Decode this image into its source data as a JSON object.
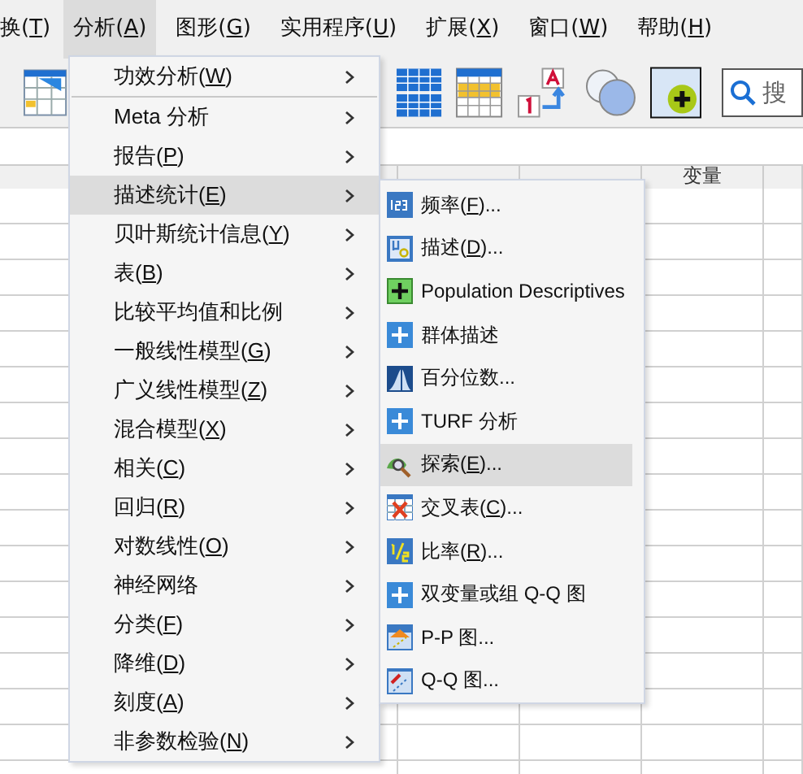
{
  "menubar": [
    {
      "label": "换(T)",
      "selected": false
    },
    {
      "label": "分析(A)",
      "selected": true
    },
    {
      "label": "图形(G)",
      "selected": false
    },
    {
      "label": "实用程序(U)",
      "selected": false
    },
    {
      "label": "扩展(X)",
      "selected": false
    },
    {
      "label": "窗口(W)",
      "selected": false
    },
    {
      "label": "帮助(H)",
      "selected": false
    }
  ],
  "toolbar": {
    "search": {
      "placeholder": "搜"
    }
  },
  "grid": {
    "column_header": "变量"
  },
  "analyze_menu": [
    {
      "label": "功效分析(W)",
      "selected": false,
      "separator_after": true
    },
    {
      "label": "Meta 分析",
      "selected": false
    },
    {
      "label": "报告(P)",
      "selected": false
    },
    {
      "label": "描述统计(E)",
      "selected": true
    },
    {
      "label": "贝叶斯统计信息(Y)",
      "selected": false
    },
    {
      "label": "表(B)",
      "selected": false
    },
    {
      "label": "比较平均值和比例",
      "selected": false
    },
    {
      "label": "一般线性模型(G)",
      "selected": false
    },
    {
      "label": "广义线性模型(Z)",
      "selected": false
    },
    {
      "label": "混合模型(X)",
      "selected": false
    },
    {
      "label": "相关(C)",
      "selected": false
    },
    {
      "label": "回归(R)",
      "selected": false
    },
    {
      "label": "对数线性(O)",
      "selected": false
    },
    {
      "label": "神经网络",
      "selected": false
    },
    {
      "label": "分类(F)",
      "selected": false
    },
    {
      "label": "降维(D)",
      "selected": false
    },
    {
      "label": "刻度(A)",
      "selected": false
    },
    {
      "label": "非参数检验(N)",
      "selected": false
    }
  ],
  "descriptives_menu": [
    {
      "label": "频率(F)...",
      "selected": false
    },
    {
      "label": "描述(D)...",
      "selected": false
    },
    {
      "label": "Population Descriptives",
      "selected": false
    },
    {
      "label": "群体描述",
      "selected": false
    },
    {
      "label": "百分位数...",
      "selected": false
    },
    {
      "label": "TURF 分析",
      "selected": false
    },
    {
      "label": "探索(E)...",
      "selected": true
    },
    {
      "label": "交叉表(C)...",
      "selected": false
    },
    {
      "label": "比率(R)...",
      "selected": false
    },
    {
      "label": "双变量或组 Q-Q 图",
      "selected": false
    },
    {
      "label": "P-P 图...",
      "selected": false
    },
    {
      "label": "Q-Q 图...",
      "selected": false
    }
  ]
}
